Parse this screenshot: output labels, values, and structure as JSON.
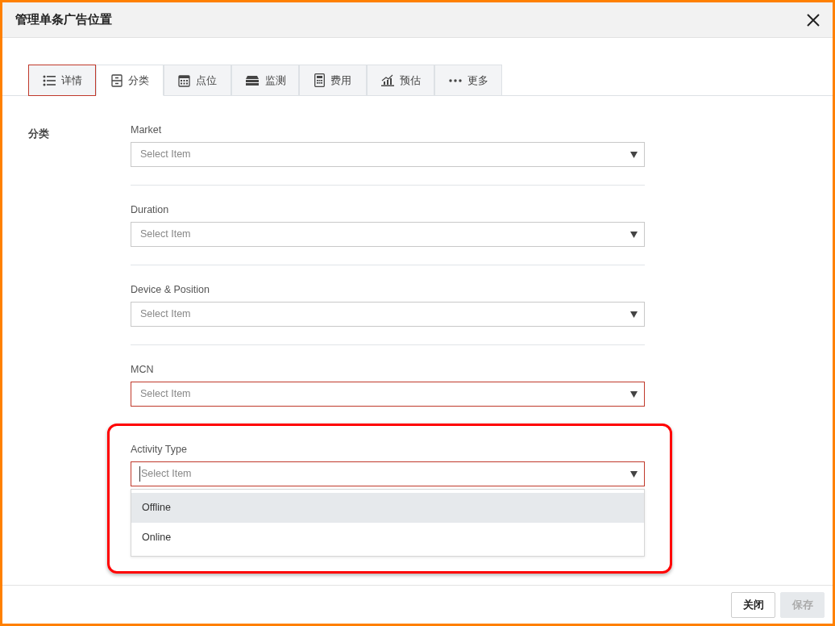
{
  "window": {
    "title": "管理单条广告位置"
  },
  "tabs": [
    {
      "label": "详情",
      "kind": "list",
      "selected": false,
      "focused": true
    },
    {
      "label": "分类",
      "kind": "drawer",
      "selected": true,
      "focused": false
    },
    {
      "label": "点位",
      "kind": "calendar",
      "selected": false,
      "focused": false
    },
    {
      "label": "监测",
      "kind": "server",
      "selected": false,
      "focused": false
    },
    {
      "label": "费用",
      "kind": "calculator",
      "selected": false,
      "focused": false
    },
    {
      "label": "预估",
      "kind": "chart",
      "selected": false,
      "focused": false
    },
    {
      "label": "更多",
      "kind": "dots",
      "selected": false,
      "focused": false
    }
  ],
  "section": {
    "title": "分类"
  },
  "fields": [
    {
      "label": "Market",
      "placeholder": "Select Item",
      "invalid": false,
      "focused": false
    },
    {
      "label": "Duration",
      "placeholder": "Select Item",
      "invalid": false,
      "focused": false
    },
    {
      "label": "Device & Position",
      "placeholder": "Select Item",
      "invalid": false,
      "focused": false
    },
    {
      "label": "MCN",
      "placeholder": "Select Item",
      "invalid": true,
      "focused": false
    },
    {
      "label": "Activity Type",
      "placeholder": "Select Item",
      "invalid": true,
      "focused": true,
      "highlighted_by_annotation": true,
      "options": [
        {
          "label": "Offline",
          "selected": true
        },
        {
          "label": "Online",
          "selected": false
        }
      ]
    }
  ],
  "buttons": [
    {
      "label": "关闭",
      "disabled": false
    },
    {
      "label": "保存",
      "disabled": true
    }
  ]
}
